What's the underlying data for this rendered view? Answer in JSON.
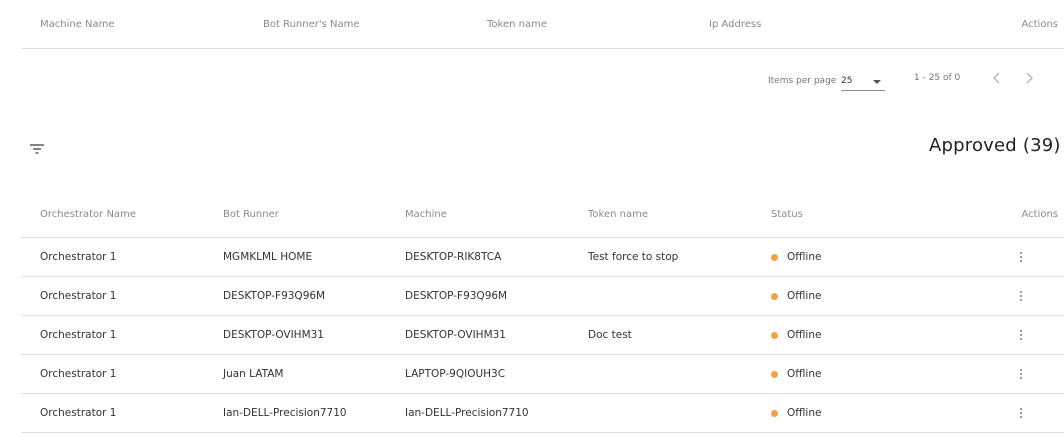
{
  "pending_table": {
    "columns": [
      "Machine Name",
      "Bot Runner's Name",
      "Token name",
      "Ip Address",
      "Actions"
    ]
  },
  "paginator": {
    "items_per_page_label": "Items per page",
    "items_per_page_value": "25",
    "range_label": "1 - 25 of 0",
    "prev_icon": "chevron-left-icon",
    "next_icon": "chevron-right-icon"
  },
  "approved_section": {
    "title": "Approved (39)",
    "filter_icon": "filter-icon"
  },
  "approved_table": {
    "columns": [
      "Orchestrator Name",
      "Bot Runner",
      "Machine",
      "Token name",
      "Status",
      "Actions"
    ],
    "status_color": "#f0a04b",
    "rows": [
      {
        "orchestrator": "Orchestrator 1",
        "bot_runner": "MGMKLML HOME",
        "machine": "DESKTOP-RIK8TCA",
        "token": "Test force to stop",
        "status": "Offline"
      },
      {
        "orchestrator": "Orchestrator 1",
        "bot_runner": "DESKTOP-F93Q96M",
        "machine": "DESKTOP-F93Q96M",
        "token": "",
        "status": "Offline"
      },
      {
        "orchestrator": "Orchestrator 1",
        "bot_runner": "DESKTOP-OVIHM31",
        "machine": "DESKTOP-OVIHM31",
        "token": "Doc test",
        "status": "Offline"
      },
      {
        "orchestrator": "Orchestrator 1",
        "bot_runner": "Juan LATAM",
        "machine": "LAPTOP-9QIOUH3C",
        "token": "",
        "status": "Offline"
      },
      {
        "orchestrator": "Orchestrator 1",
        "bot_runner": "Ian-DELL-Precision7710",
        "machine": "Ian-DELL-Precision7710",
        "token": "",
        "status": "Offline"
      }
    ]
  }
}
